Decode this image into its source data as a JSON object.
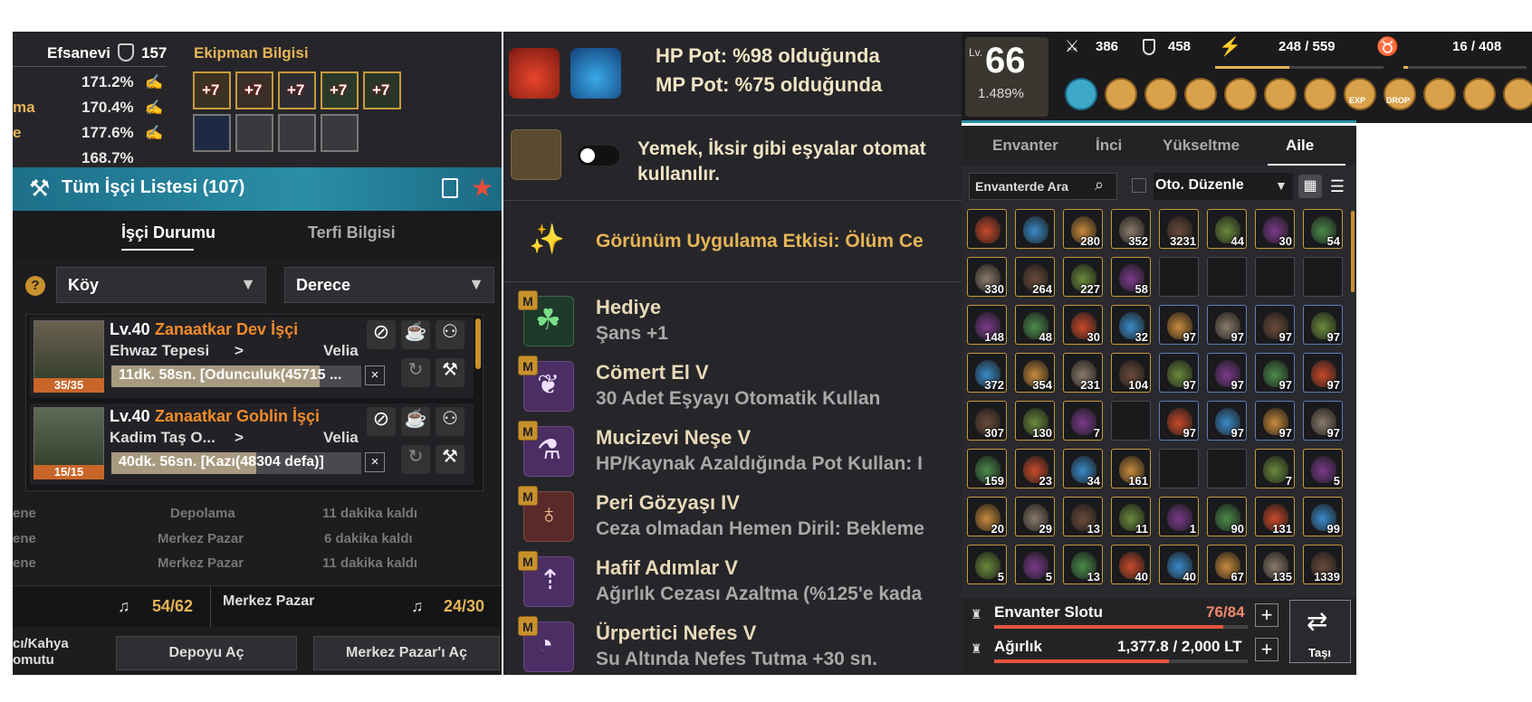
{
  "left": {
    "rarity": "Efsanevi",
    "gear_score": "157",
    "equip_title": "Ekipman Bilgisi",
    "stats": [
      {
        "label": "",
        "value": "171.2%"
      },
      {
        "label": "ma",
        "value": "170.4%"
      },
      {
        "label": "e",
        "value": "177.6%"
      },
      {
        "label": "",
        "value": "168.7%"
      }
    ],
    "equip_row1": [
      "+7",
      "+7",
      "+7",
      "+7",
      "+7"
    ],
    "worker_list_title": "Tüm İşçi Listesi (107)",
    "tabs": [
      "İşçi Durumu",
      "Terfi Bilgisi"
    ],
    "filter_town": "Köy",
    "filter_grade": "Derece",
    "workers": [
      {
        "level": "Lv.40",
        "name": "Zanaatkar Dev İşçi",
        "location": "Ehwaz Tepesi",
        "arrow": ">",
        "town": "Velia",
        "stamina": "35/35",
        "task": "11dk. 58sn. [Odunculuk(45715 ..."
      },
      {
        "level": "Lv.40",
        "name": "Zanaatkar Goblin İşçi",
        "location": "Kadim Taş O...",
        "arrow": ">",
        "town": "Velia",
        "stamina": "15/15",
        "task": "40dk. 56sn. [Kazı(48304 defa)]"
      }
    ],
    "queue": [
      {
        "a": "ene",
        "b": "Depolama",
        "c": "11 dakika kaldı"
      },
      {
        "a": "ene",
        "b": "Merkez Pazar",
        "c": "6 dakika kaldı"
      },
      {
        "a": "ene",
        "b": "Merkez Pazar",
        "c": "11 dakika kaldı"
      }
    ],
    "count_left": "54/62",
    "market_label": "Merkez Pazar",
    "count_right": "24/30",
    "bottom_label": "cı/Kahya omutu",
    "btn_storage": "Depoyu Aç",
    "btn_market": "Merkez Pazar'ı Aç"
  },
  "mid": {
    "hp_pot": "HP Pot: %98 olduğunda",
    "mp_pot": "MP Pot: %75 olduğunda",
    "auto_use": "Yemek, İksir gibi eşyalar otomat",
    "auto_use_2": "kullanılır.",
    "appearance": "Görünüm Uygulama Etkisi: Ölüm Ce",
    "m_badge": "M",
    "skills": [
      {
        "name": "Hediye",
        "desc": "Şans +1"
      },
      {
        "name": "Cömert El V",
        "desc": "30 Adet Eşyayı Otomatik Kullan"
      },
      {
        "name": "Mucizevi Neşe V",
        "desc": "HP/Kaynak Azaldığında Pot Kullan: I"
      },
      {
        "name": "Peri Gözyaşı IV",
        "desc": "Ceza olmadan Hemen Diril: Bekleme"
      },
      {
        "name": "Hafif Adımlar V",
        "desc": "Ağırlık Cezası Azaltma (%125'e kada"
      },
      {
        "name": "Ürpertici Nefes V",
        "desc": "Su Altında Nefes Tutma +30 sn."
      }
    ]
  },
  "hud": {
    "lv_label": "Lv.",
    "level": "66",
    "exp": "1.489%",
    "attack": "386",
    "defense": "458",
    "energy": "248 / 559",
    "contrib": "16 / 408",
    "energy_fraction": 0.44,
    "contrib_fraction": 0.04,
    "exp_label": "EXP",
    "drop_label": "DROP"
  },
  "inventory": {
    "tabs": [
      "Envanter",
      "İnci",
      "Yükseltme",
      "Aile"
    ],
    "active_tab": "Aile",
    "search_placeholder": "Envanterde Ara",
    "sort_label": "Oto. Düzenle",
    "slots_label": "Envanter Slotu",
    "slots_value": "76/84",
    "slots_fraction": 0.905,
    "weight_label": "Ağırlık",
    "weight_value": "1,377.8 / 2,000 LT",
    "weight_fraction": 0.689,
    "move_label": "Taşı",
    "items": [
      [
        "",
        "",
        "280",
        "352",
        "3231",
        "44",
        "30",
        "54"
      ],
      [
        "330",
        "264",
        "227",
        "58",
        "",
        "",
        "",
        ""
      ],
      [
        "148",
        "48",
        "30",
        "32",
        "97",
        "97",
        "97",
        "97"
      ],
      [
        "372",
        "354",
        "231",
        "104",
        "97",
        "97",
        "97",
        "97"
      ],
      [
        "307",
        "130",
        "7",
        "",
        "97",
        "97",
        "97",
        "97"
      ],
      [
        "159",
        "23",
        "34",
        "161",
        "",
        "",
        "7",
        "5"
      ],
      [
        "20",
        "29",
        "13",
        "11",
        "1",
        "90",
        "131",
        "99"
      ],
      [
        "5",
        "5",
        "13",
        "40",
        "40",
        "67",
        "135",
        "1339"
      ]
    ]
  }
}
